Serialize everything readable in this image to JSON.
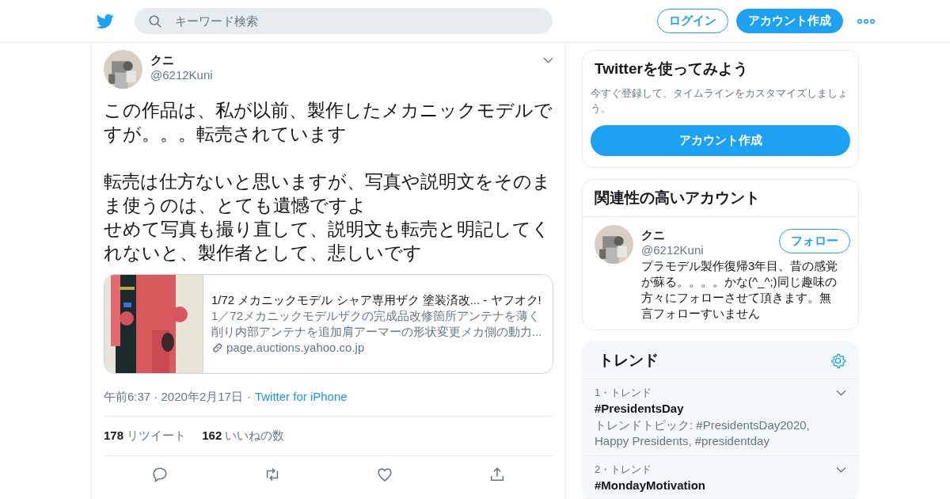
{
  "header": {
    "search": {
      "placeholder": "キーワード検索"
    },
    "login_button": "ログイン",
    "signup_button": "アカウント作成"
  },
  "tweet": {
    "author": {
      "name": "クニ",
      "handle": "@6212Kuni"
    },
    "paragraphs": [
      [
        "この作品は、私が以前、製作したメカニックモデルですが。。。転売されています"
      ],
      [
        "転売は仕方ないと思いますが、写真や説明文をそのまま使うのは、とても遺憾ですよ",
        "せめて写真も撮り直して、説明文も転売と明記してくれないと、製作者として、悲しいです"
      ]
    ],
    "card": {
      "title": "1/72 メカニックモデル シャア専用ザク 塗装済改... - ヤフオク!",
      "description": "1／72メカニックモデルザクの完成品改修箇所アンテナを薄く削り内部アンテナを追加肩アーマーの形状変更メカ側の動力...",
      "domain": "page.auctions.yahoo.co.jp"
    },
    "time": "午前6:37 · 2020年2月17日",
    "separator": "·",
    "source": "Twitter for iPhone",
    "stats": [
      {
        "count": "178",
        "label": "リツイート"
      },
      {
        "count": "162",
        "label": "いいねの数"
      }
    ]
  },
  "sidebar": {
    "signup_panel": {
      "title": "Twitterを使ってみよう",
      "text": "今すぐ登録して、タイムラインをカスタマイズしましょう。",
      "button": "アカウント作成"
    },
    "related": {
      "title": "関連性の高いアカウント",
      "accounts": [
        {
          "name": "クニ",
          "handle": "@6212Kuni",
          "button": "フォロー",
          "bio": "プラモデル製作復帰3年目、昔の感覚が蘇る。。。。かな(^_^;)同じ趣味の方々にフォローさせて頂きます。無言フォローすいません"
        }
      ]
    },
    "trends": {
      "title": "トレンド",
      "items": [
        {
          "rank": "1・トレンド",
          "name": "#PresidentsDay",
          "topics": "トレンドトピック: #PresidentsDay2020, Happy Presidents, #presidentday"
        },
        {
          "rank": "2・トレンド",
          "name": "#MondayMotivation"
        }
      ]
    }
  }
}
